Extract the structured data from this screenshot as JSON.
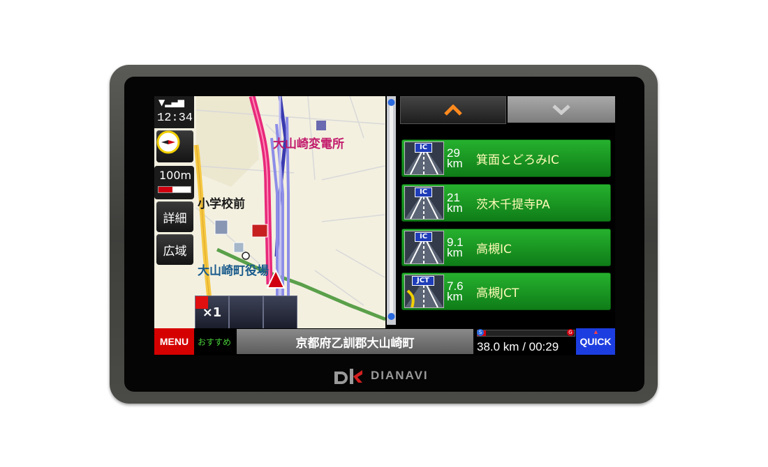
{
  "brand": {
    "logo_text": "DIANAVI"
  },
  "status": {
    "signal_icon": "signal-icon",
    "clock": "12:34"
  },
  "map": {
    "scale_label": "100m",
    "detail_button": "詳細",
    "wide_button": "広域",
    "labels": {
      "substation": "大山崎変電所",
      "school": "小学校前",
      "town_office": "大山崎町役場"
    },
    "playback": {
      "speed": "×1",
      "pause_icon": "pause-icon",
      "stop_icon": "stop-icon"
    }
  },
  "exit_list": {
    "up_icon": "chevron-up-icon",
    "down_icon": "chevron-down-icon",
    "items": [
      {
        "tag": "IC",
        "distance": "29",
        "unit": "km",
        "name": "箕面とどろみIC"
      },
      {
        "tag": "IC",
        "distance": "21",
        "unit": "km",
        "name": "茨木千提寺PA"
      },
      {
        "tag": "IC",
        "distance": "9.1",
        "unit": "km",
        "name": "高槻IC"
      },
      {
        "tag": "JCT",
        "distance": "7.6",
        "unit": "km",
        "name": "高槻JCT"
      }
    ]
  },
  "bottom": {
    "menu": "MENU",
    "recommend": "おすすめ",
    "address": "京都府乙訓郡大山崎町",
    "start_marker": "S",
    "goal_marker": "G",
    "distance_time": "38.0 km / 00:29",
    "quick": "QUICK"
  },
  "colors": {
    "accent_green": "#1a9a22",
    "menu_red": "#d50000",
    "quick_blue": "#1c3ee0"
  }
}
